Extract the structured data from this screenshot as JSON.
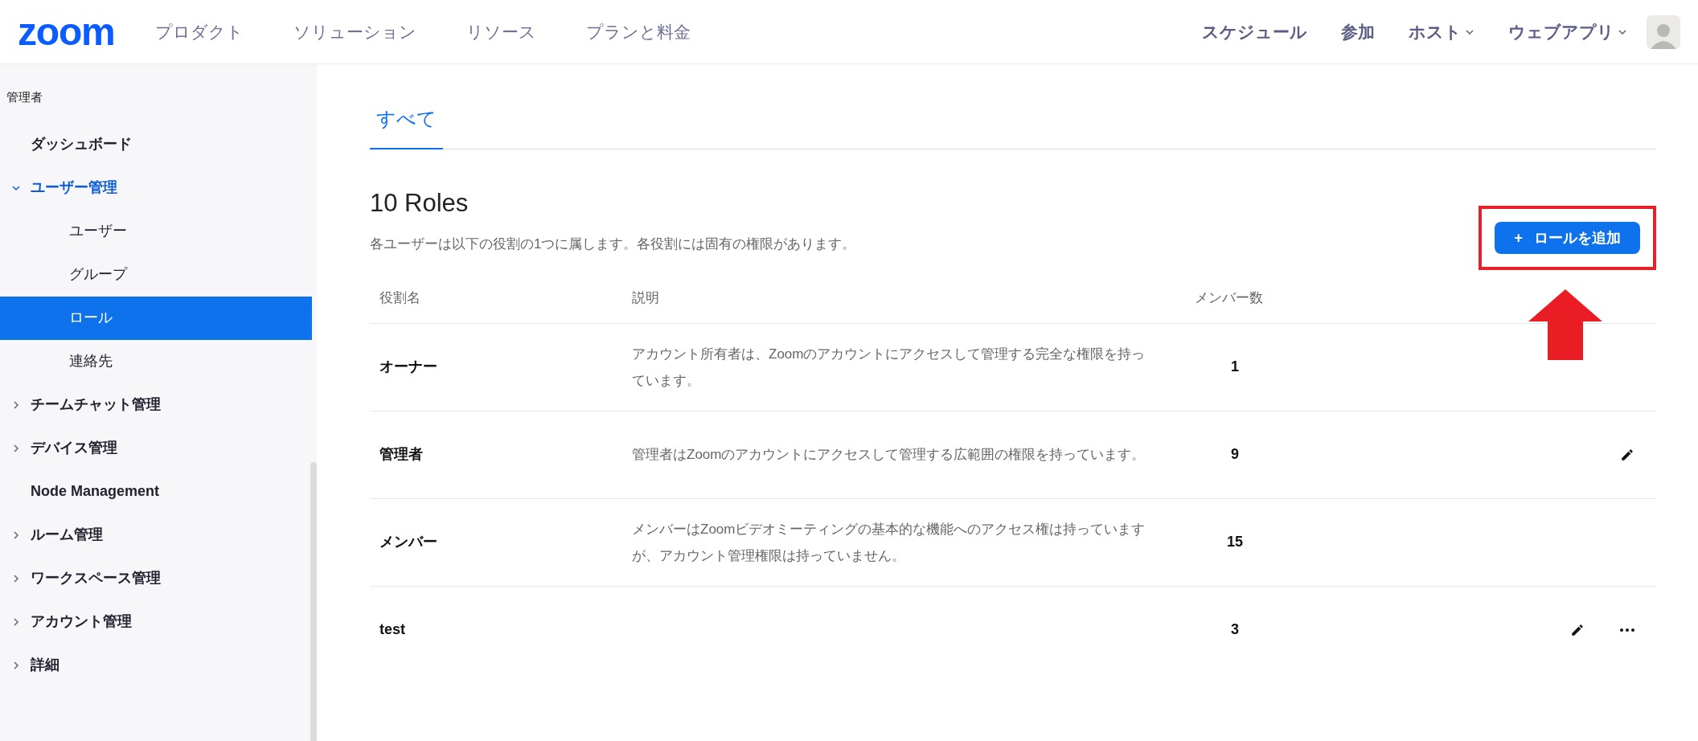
{
  "header": {
    "logo": "zoom",
    "nav": [
      {
        "label": "プロダクト"
      },
      {
        "label": "ソリューション"
      },
      {
        "label": "リソース"
      },
      {
        "label": "プランと料金"
      }
    ],
    "right_nav": [
      {
        "label": "スケジュール",
        "dropdown": false
      },
      {
        "label": "参加",
        "dropdown": false
      },
      {
        "label": "ホスト",
        "dropdown": true
      },
      {
        "label": "ウェブアプリ",
        "dropdown": true
      }
    ]
  },
  "sidebar": {
    "heading": "管理者",
    "items": [
      {
        "label": "ダッシュボード",
        "selected": false
      },
      {
        "label": "ユーザー管理",
        "expanded": true,
        "selected": false,
        "children": [
          {
            "label": "ユーザー",
            "selected": false
          },
          {
            "label": "グループ",
            "selected": false
          },
          {
            "label": "ロール",
            "selected": true
          },
          {
            "label": "連絡先",
            "selected": false
          }
        ]
      },
      {
        "label": "チームチャット管理",
        "expanded": false,
        "selected": false
      },
      {
        "label": "デバイス管理",
        "expanded": false,
        "selected": false
      },
      {
        "label": "Node Management",
        "selected": false
      },
      {
        "label": "ルーム管理",
        "expanded": false,
        "selected": false
      },
      {
        "label": "ワークスペース管理",
        "expanded": false,
        "selected": false
      },
      {
        "label": "アカウント管理",
        "expanded": false,
        "selected": false
      },
      {
        "label": "詳細",
        "expanded": false,
        "selected": false
      }
    ]
  },
  "tabs": [
    {
      "label": "すべて",
      "selected": true
    }
  ],
  "title": "10 Roles",
  "subtitle": "各ユーザーは以下の役割の1つに属します。各役割には固有の権限があります。",
  "add_button": {
    "icon": "+",
    "label": "ロールを追加"
  },
  "table": {
    "columns": [
      "役割名",
      "説明",
      "メンバー数"
    ],
    "rows": [
      {
        "name": "オーナー",
        "description": "アカウント所有者は、Zoomのアカウントにアクセスして管理する完全な権限を持っています。",
        "members": "1",
        "actions": []
      },
      {
        "name": "管理者",
        "description": "管理者はZoomのアカウントにアクセスして管理する広範囲の権限を持っています。",
        "members": "9",
        "actions": [
          {
            "kind": "edit"
          }
        ]
      },
      {
        "name": "メンバー",
        "description": "メンバーはZoomビデオミーティングの基本的な機能へのアクセス権は持っていますが、アカウント管理権限は持っていません。",
        "members": "15",
        "actions": []
      },
      {
        "name": "test",
        "description": "",
        "members": "3",
        "actions": [
          {
            "kind": "edit"
          },
          {
            "kind": "more"
          }
        ]
      }
    ]
  }
}
